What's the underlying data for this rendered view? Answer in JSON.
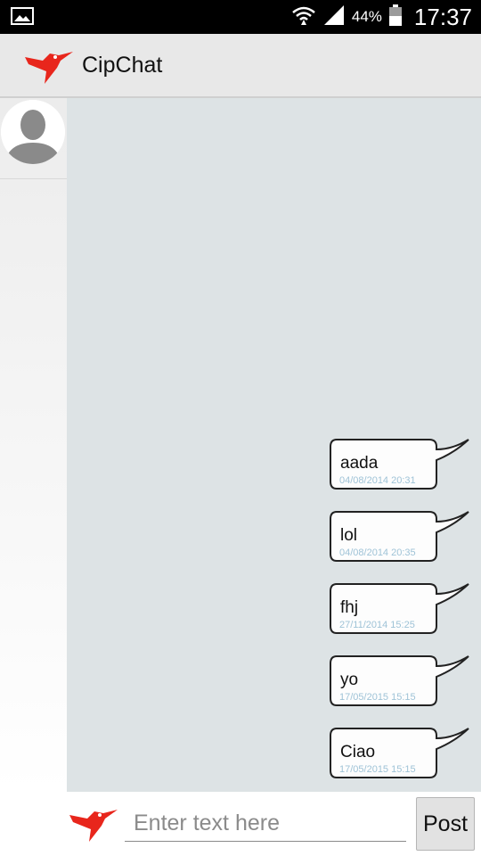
{
  "status_bar": {
    "battery_percent": "44%",
    "time": "17:37",
    "icons": [
      "image-icon",
      "wifi-icon",
      "signal-icon",
      "battery-icon"
    ]
  },
  "app_bar": {
    "title": "CipChat",
    "logo_icon": "hummingbird-logo-icon"
  },
  "contacts": [
    {
      "avatar_icon": "default-user-avatar-icon"
    }
  ],
  "messages": [
    {
      "text": "aada",
      "time": "04/08/2014 20:31"
    },
    {
      "text": "lol",
      "time": "04/08/2014 20:35"
    },
    {
      "text": "fhj",
      "time": "27/11/2014 15:25"
    },
    {
      "text": "yo",
      "time": "17/05/2015 15:15"
    },
    {
      "text": "Ciao",
      "time": "17/05/2015 15:15"
    }
  ],
  "composer": {
    "placeholder": "Enter text here",
    "value": "",
    "post_label": "Post"
  },
  "colors": {
    "chat_background": "#dde3e5",
    "app_bar": "#e8e8e8",
    "logo_red": "#e8261c",
    "timestamp": "#9fc3d7"
  }
}
